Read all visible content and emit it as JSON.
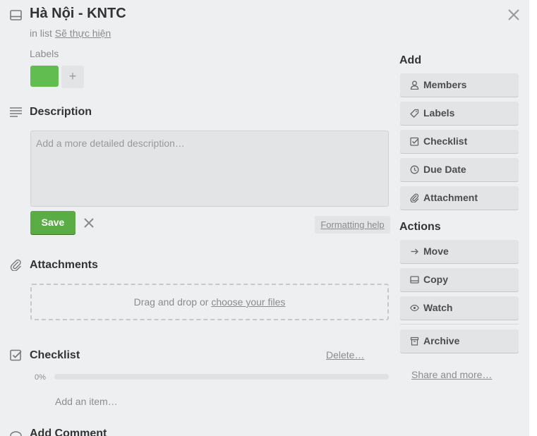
{
  "card": {
    "title": "Hà Nội - KNTC",
    "in_list_prefix": "in list",
    "list_name": "Sẽ thực hiện"
  },
  "labels": {
    "heading": "Labels",
    "chips": [
      {
        "color": "#61bd4f"
      }
    ],
    "add_symbol": "+"
  },
  "description": {
    "heading": "Description",
    "placeholder": "Add a more detailed description…",
    "save_label": "Save",
    "formatting_help": "Formatting help"
  },
  "attachments": {
    "heading": "Attachments",
    "drop_text": "Drag and drop or",
    "choose_files": "choose your files"
  },
  "checklist": {
    "heading": "Checklist",
    "delete_label": "Delete…",
    "percent_label": "0%",
    "progress_fraction": 0,
    "add_item": "Add an item…"
  },
  "comment": {
    "heading": "Add Comment"
  },
  "sidebar": {
    "add_heading": "Add",
    "add_buttons": [
      {
        "label": "Members",
        "icon": "person-icon"
      },
      {
        "label": "Labels",
        "icon": "tag-icon"
      },
      {
        "label": "Checklist",
        "icon": "checkbox-icon"
      },
      {
        "label": "Due Date",
        "icon": "clock-icon"
      },
      {
        "label": "Attachment",
        "icon": "paperclip-icon"
      }
    ],
    "actions_heading": "Actions",
    "action_buttons": [
      {
        "label": "Move",
        "icon": "arrow-right-icon"
      },
      {
        "label": "Copy",
        "icon": "card-icon"
      },
      {
        "label": "Watch",
        "icon": "eye-icon"
      },
      {
        "label": "Archive",
        "icon": "archive-icon"
      }
    ],
    "share_link": "Share and more…"
  },
  "colors": {
    "accent_green": "#5aac44",
    "label_green": "#61bd4f",
    "panel_bg": "#edeff0"
  }
}
